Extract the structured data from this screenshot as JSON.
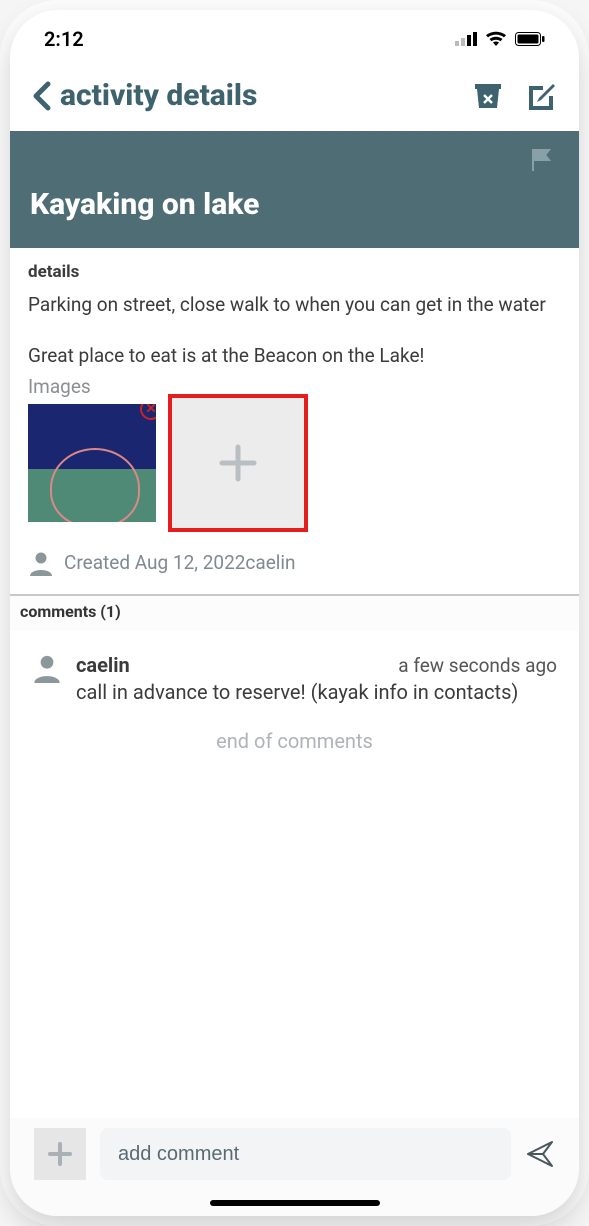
{
  "status": {
    "time": "2:12"
  },
  "nav": {
    "title": "activity details"
  },
  "hero": {
    "title": "Kayaking on lake"
  },
  "details": {
    "label": "details",
    "body": "Parking on street, close walk to when you can get in the water\n\nGreat place to eat is at the Beacon on the Lake!",
    "images_label": "Images",
    "created_text": "Created Aug 12, 2022caelin"
  },
  "comments": {
    "header": "comments (1)",
    "list": [
      {
        "author": "caelin",
        "time": "a few seconds ago",
        "text": "call in advance to reserve! (kayak info in contacts)"
      }
    ],
    "end_text": "end of comments"
  },
  "composer": {
    "placeholder": "add comment"
  }
}
